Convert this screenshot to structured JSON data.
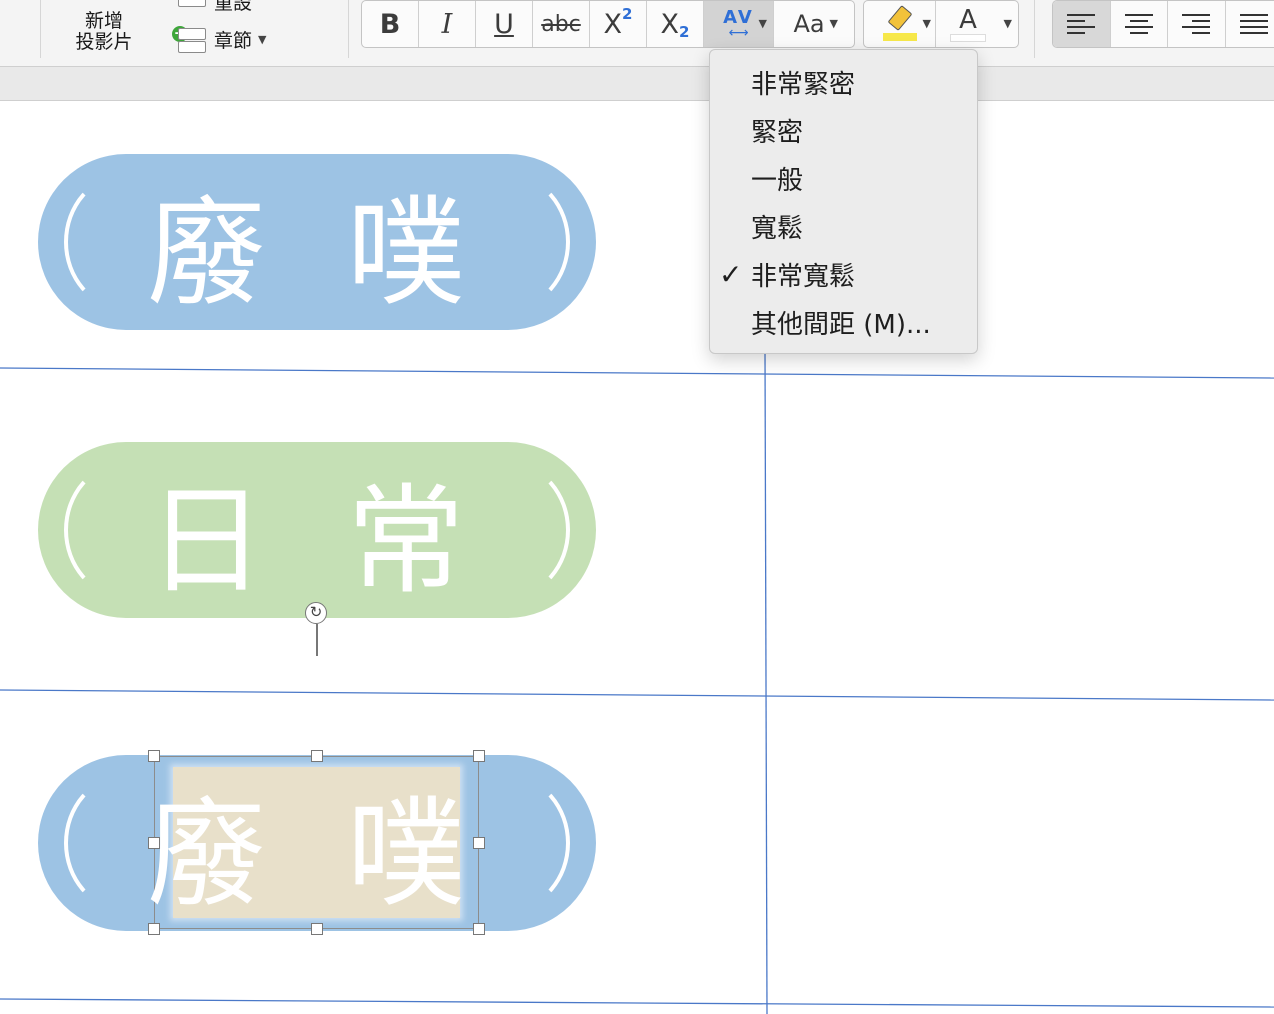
{
  "ribbon": {
    "new_slide_label": "新增\n投影片",
    "reset_label": "重設",
    "section_label": "章節",
    "format_buttons": [
      {
        "name": "bold-button",
        "label": "B"
      },
      {
        "name": "italic-button",
        "label": "I"
      },
      {
        "name": "underline-button",
        "label": "U"
      },
      {
        "name": "strikethrough-button",
        "label": "abc"
      },
      {
        "name": "superscript-button",
        "label": "X",
        "mark": "2"
      },
      {
        "name": "subscript-button",
        "label": "X",
        "mark": "2"
      }
    ],
    "spacing_button_label": "AV",
    "change_case_label": "Aa",
    "font_color_label": "A",
    "accent_colors": {
      "highlight": "#f7e84a",
      "subscript": "#2f6fd6",
      "active": "#d3d3d3"
    }
  },
  "spacing_menu": {
    "items": [
      {
        "label": "非常緊密",
        "checked": false
      },
      {
        "label": "緊密",
        "checked": false
      },
      {
        "label": "一般",
        "checked": false
      },
      {
        "label": "寬鬆",
        "checked": false
      },
      {
        "label": "非常寬鬆",
        "checked": true
      },
      {
        "label": "其他間距 (M)...",
        "checked": false
      }
    ],
    "check_glyph": "✓"
  },
  "slide": {
    "pills": [
      {
        "text": "廢 噗",
        "color": "#9dc3e4"
      },
      {
        "text": "日 常",
        "color": "#c5e0b5"
      },
      {
        "text": "廢 噗",
        "color": "#9dc3e4"
      }
    ],
    "selected_box_color": "#e8e0ca"
  }
}
